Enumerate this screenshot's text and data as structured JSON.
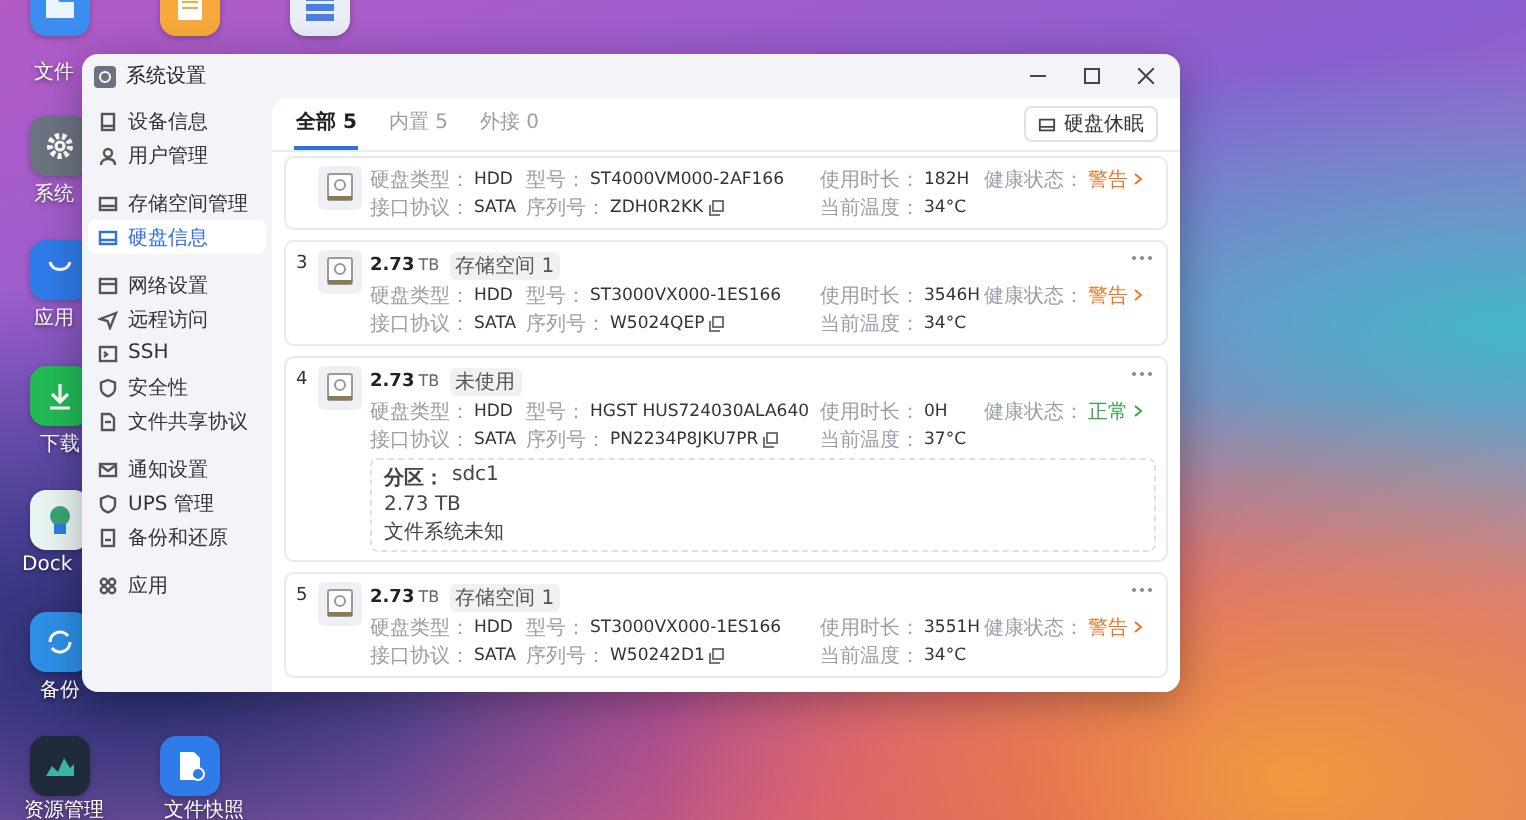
{
  "desktop": {
    "icons": [
      {
        "kind": "folder",
        "label": "文件"
      },
      {
        "kind": "notes"
      },
      {
        "kind": "server"
      },
      {
        "kind": "gear",
        "label": "系统"
      },
      {
        "kind": "store",
        "label": "应用"
      },
      {
        "kind": "download",
        "label": "下载"
      },
      {
        "kind": "docker",
        "label": "Dock"
      },
      {
        "kind": "sync",
        "label": "备份"
      },
      {
        "kind": "monitor",
        "label": "资源管理"
      },
      {
        "kind": "snapshot",
        "label": "文件快照"
      }
    ]
  },
  "window": {
    "title": "系统设置"
  },
  "sidebar": {
    "groups": [
      [
        {
          "label": "设备信息",
          "selected": false
        },
        {
          "label": "用户管理",
          "selected": false
        }
      ],
      [
        {
          "label": "存储空间管理",
          "selected": false
        },
        {
          "label": "硬盘信息",
          "selected": true
        }
      ],
      [
        {
          "label": "网络设置",
          "selected": false
        },
        {
          "label": "远程访问",
          "selected": false
        },
        {
          "label": "SSH",
          "selected": false
        },
        {
          "label": "安全性",
          "selected": false
        },
        {
          "label": "文件共享协议",
          "selected": false
        }
      ],
      [
        {
          "label": "通知设置",
          "selected": false
        },
        {
          "label": "UPS 管理",
          "selected": false
        },
        {
          "label": "备份和还原",
          "selected": false
        }
      ],
      [
        {
          "label": "应用",
          "selected": false
        }
      ]
    ]
  },
  "tabs": [
    {
      "label": "全部 5",
      "selected": true
    },
    {
      "label": "内置 5",
      "selected": false
    },
    {
      "label": "外接 0",
      "selected": false
    }
  ],
  "sleep_button": {
    "label": "硬盘休眠"
  },
  "disks": [
    {
      "fields": [
        {
          "kind": "text",
          "label": "硬盘类型：",
          "value": "HDD"
        },
        {
          "kind": "text",
          "label": "型号：",
          "value": "ST4000VM000-2AF166"
        },
        {
          "kind": "text",
          "label": "使用时长：",
          "value": "182H"
        },
        {
          "kind": "health",
          "label": "健康状态：",
          "value": "警告",
          "color": "#e8792b"
        },
        {
          "kind": "text",
          "label": "接口协议：",
          "value": "SATA"
        },
        {
          "kind": "copy",
          "label": "序列号：",
          "value": "ZDH0R2KK"
        },
        {
          "kind": "text",
          "label": "当前温度：",
          "value": "34°C"
        }
      ]
    },
    {
      "number": "3",
      "size": "2.73",
      "unit": "TB",
      "tag": "存储空间 1",
      "fields": [
        {
          "kind": "text",
          "label": "硬盘类型：",
          "value": "HDD"
        },
        {
          "kind": "text",
          "label": "型号：",
          "value": "ST3000VX000-1ES166"
        },
        {
          "kind": "text",
          "label": "使用时长：",
          "value": "3546H"
        },
        {
          "kind": "health",
          "label": "健康状态：",
          "value": "警告",
          "color": "#e8792b"
        },
        {
          "kind": "text",
          "label": "接口协议：",
          "value": "SATA"
        },
        {
          "kind": "copy",
          "label": "序列号：",
          "value": "W5024QEP"
        },
        {
          "kind": "text",
          "label": "当前温度：",
          "value": "34°C"
        }
      ]
    },
    {
      "number": "4",
      "size": "2.73",
      "unit": "TB",
      "tag": "未使用",
      "fields": [
        {
          "kind": "text",
          "label": "硬盘类型：",
          "value": "HDD"
        },
        {
          "kind": "text",
          "label": "型号：",
          "value": "HGST HUS724030ALA640"
        },
        {
          "kind": "text",
          "label": "使用时长：",
          "value": "0H"
        },
        {
          "kind": "health",
          "label": "健康状态：",
          "value": "正常",
          "color": "#3aa54a"
        },
        {
          "kind": "text",
          "label": "接口协议：",
          "value": "SATA"
        },
        {
          "kind": "copy",
          "label": "序列号：",
          "value": "PN2234P8JKU7PR"
        },
        {
          "kind": "text",
          "label": "当前温度：",
          "value": "37°C"
        }
      ],
      "partition": {
        "label": "分区：",
        "name": "sdc1",
        "size": "2.73 TB",
        "filesystem": "文件系统未知"
      }
    },
    {
      "number": "5",
      "size": "2.73",
      "unit": "TB",
      "tag": "存储空间 1",
      "fields": [
        {
          "kind": "text",
          "label": "硬盘类型：",
          "value": "HDD"
        },
        {
          "kind": "text",
          "label": "型号：",
          "value": "ST3000VX000-1ES166"
        },
        {
          "kind": "text",
          "label": "使用时长：",
          "value": "3551H"
        },
        {
          "kind": "health",
          "label": "健康状态：",
          "value": "警告",
          "color": "#e8792b"
        },
        {
          "kind": "text",
          "label": "接口协议：",
          "value": "SATA"
        },
        {
          "kind": "copy",
          "label": "序列号：",
          "value": "W50242D1"
        },
        {
          "kind": "text",
          "label": "当前温度：",
          "value": "34°C"
        }
      ]
    }
  ]
}
